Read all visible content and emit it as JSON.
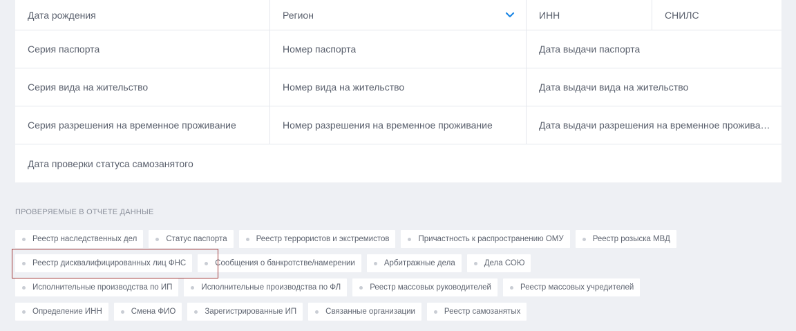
{
  "form": {
    "row1": {
      "birth_date": "Дата рождения",
      "region": "Регион",
      "inn": "ИНН",
      "snils": "СНИЛС"
    },
    "row2": {
      "passport_series": "Серия паспорта",
      "passport_number": "Номер паспорта",
      "passport_issue_date": "Дата выдачи паспорта"
    },
    "row3": {
      "residence_series": "Серия вида на жительство",
      "residence_number": "Номер вида на жительство",
      "residence_issue_date": "Дата выдачи вида на жительство"
    },
    "row4": {
      "temp_permit_series": "Серия разрешения на временное проживание",
      "temp_permit_number": "Номер разрешения на временное проживание",
      "temp_permit_issue_date": "Дата выдачи разрешения на временное проживание"
    },
    "row5": {
      "self_employed_check_date": "Дата проверки статуса самозанятого"
    }
  },
  "checked_data": {
    "title": "Проверяемые в отчете данные",
    "rows": [
      [
        "Реестр наследственных дел",
        "Статус паспорта",
        "Реестр террористов и экстремистов",
        "Причастность к распространению ОМУ",
        "Реестр розыска МВД"
      ],
      [
        "Реестр дисквалифицированных лиц ФНС",
        "Сообщения о банкротстве/намерении",
        "Арбитражные дела",
        "Дела СОЮ"
      ],
      [
        "Исполнительные производства по ИП",
        "Исполнительные производства по ФЛ",
        "Реестр массовых руководителей",
        "Реестр массовых учредителей"
      ],
      [
        "Определение ИНН",
        "Смена ФИО",
        "Зарегистрированные ИП",
        "Связанные организации",
        "Реестр самозанятых"
      ]
    ]
  },
  "colors": {
    "accent": "#1e88e5",
    "highlight_border": "#a33a3a"
  },
  "icons": {
    "region_dropdown": "chevron-down-icon",
    "chip_bullet": "dot-icon"
  }
}
